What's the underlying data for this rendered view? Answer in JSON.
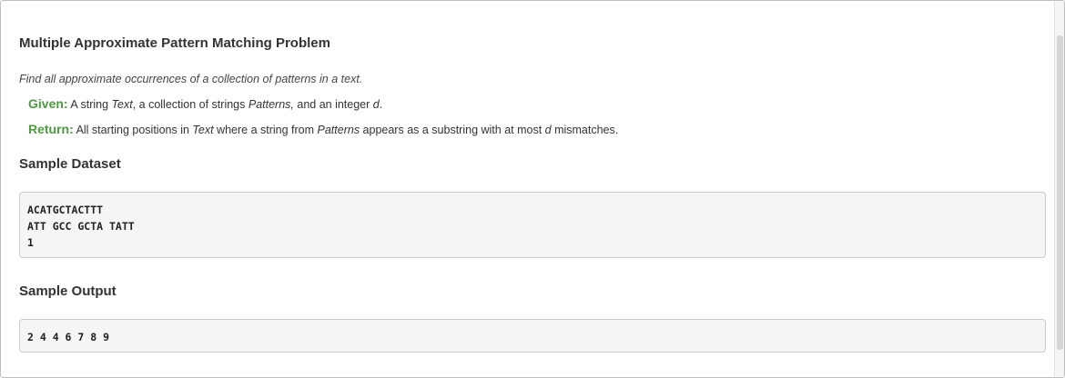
{
  "problem": {
    "title": "Multiple Approximate Pattern Matching Problem",
    "intro": "Find all approximate occurrences of a collection of patterns in a text.",
    "given": {
      "keyword": "Given:",
      "parts": [
        " A string ",
        "Text",
        ", a collection of strings ",
        "Patterns,",
        " and an integer ",
        "d",
        "."
      ]
    },
    "return": {
      "keyword": "Return:",
      "parts": [
        " All starting positions in ",
        "Text",
        " where a string from ",
        "Patterns",
        " appears as a substring with at most ",
        "d",
        " mismatches."
      ]
    }
  },
  "sample_dataset": {
    "heading": "Sample Dataset",
    "lines": [
      "ACATGCTACTTT",
      "ATT GCC GCTA TATT",
      "1"
    ]
  },
  "sample_output": {
    "heading": "Sample Output",
    "lines": [
      "2 4 4 6 7 8 9"
    ]
  }
}
